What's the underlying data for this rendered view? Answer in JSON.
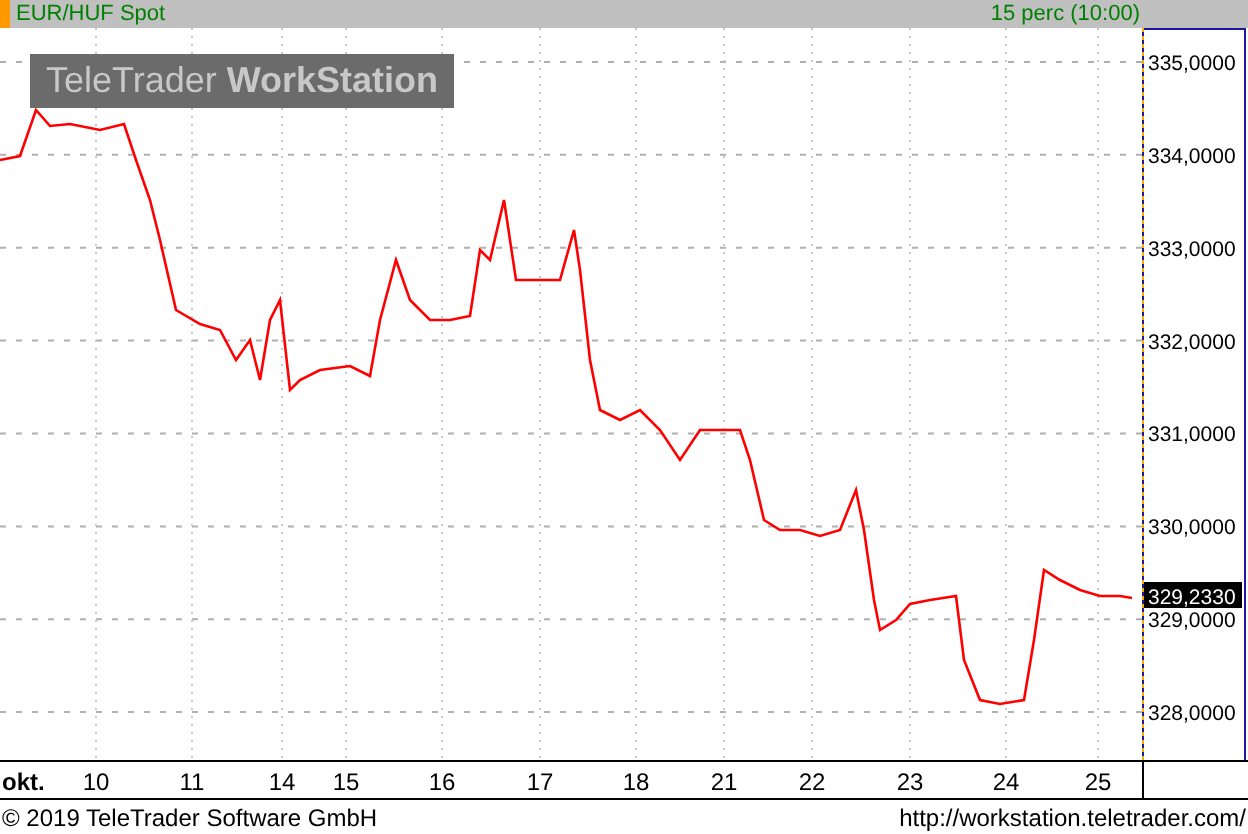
{
  "header": {
    "symbol": "EUR/HUF Spot",
    "interval": "15 perc (10:00)"
  },
  "badge": "TeleTrader **WorkStation**",
  "chart": {
    "last_price": "329,2330",
    "month_label": "okt.",
    "y_axis_labels": [
      "335,0000",
      "334,0000",
      "333,0000",
      "332,0000",
      "331,0000",
      "330,0000",
      "329,0000",
      "328,0000"
    ],
    "x_axis_labels": [
      "10",
      "11",
      "14",
      "15",
      "16",
      "17",
      "18",
      "21",
      "22",
      "23",
      "24",
      "25"
    ]
  },
  "footer": {
    "copyright": "© 2019 TeleTrader Software GmbH",
    "url": "http://workstation.teletrader.com/"
  }
}
